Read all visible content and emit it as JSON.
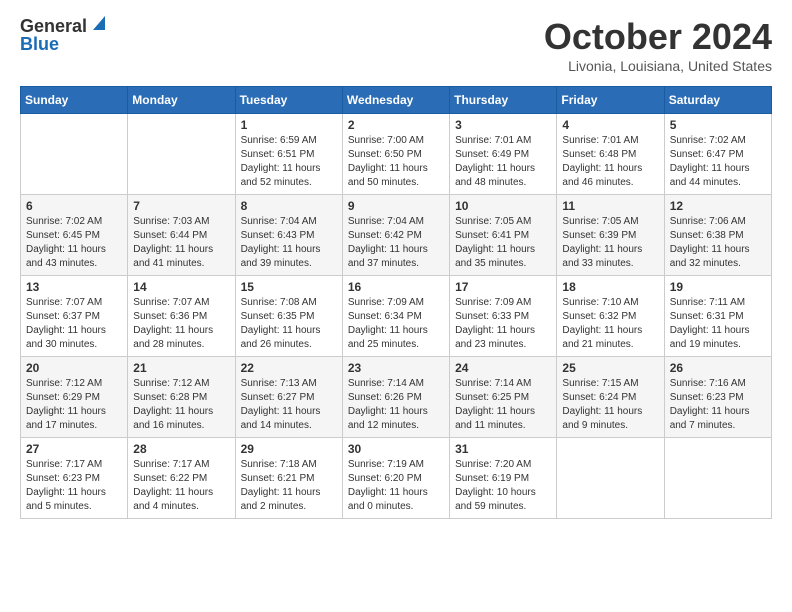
{
  "logo": {
    "general": "General",
    "blue": "Blue"
  },
  "header": {
    "month": "October 2024",
    "location": "Livonia, Louisiana, United States"
  },
  "weekdays": [
    "Sunday",
    "Monday",
    "Tuesday",
    "Wednesday",
    "Thursday",
    "Friday",
    "Saturday"
  ],
  "weeks": [
    [
      {
        "day": "",
        "info": ""
      },
      {
        "day": "",
        "info": ""
      },
      {
        "day": "1",
        "info": "Sunrise: 6:59 AM\nSunset: 6:51 PM\nDaylight: 11 hours\nand 52 minutes."
      },
      {
        "day": "2",
        "info": "Sunrise: 7:00 AM\nSunset: 6:50 PM\nDaylight: 11 hours\nand 50 minutes."
      },
      {
        "day": "3",
        "info": "Sunrise: 7:01 AM\nSunset: 6:49 PM\nDaylight: 11 hours\nand 48 minutes."
      },
      {
        "day": "4",
        "info": "Sunrise: 7:01 AM\nSunset: 6:48 PM\nDaylight: 11 hours\nand 46 minutes."
      },
      {
        "day": "5",
        "info": "Sunrise: 7:02 AM\nSunset: 6:47 PM\nDaylight: 11 hours\nand 44 minutes."
      }
    ],
    [
      {
        "day": "6",
        "info": "Sunrise: 7:02 AM\nSunset: 6:45 PM\nDaylight: 11 hours\nand 43 minutes."
      },
      {
        "day": "7",
        "info": "Sunrise: 7:03 AM\nSunset: 6:44 PM\nDaylight: 11 hours\nand 41 minutes."
      },
      {
        "day": "8",
        "info": "Sunrise: 7:04 AM\nSunset: 6:43 PM\nDaylight: 11 hours\nand 39 minutes."
      },
      {
        "day": "9",
        "info": "Sunrise: 7:04 AM\nSunset: 6:42 PM\nDaylight: 11 hours\nand 37 minutes."
      },
      {
        "day": "10",
        "info": "Sunrise: 7:05 AM\nSunset: 6:41 PM\nDaylight: 11 hours\nand 35 minutes."
      },
      {
        "day": "11",
        "info": "Sunrise: 7:05 AM\nSunset: 6:39 PM\nDaylight: 11 hours\nand 33 minutes."
      },
      {
        "day": "12",
        "info": "Sunrise: 7:06 AM\nSunset: 6:38 PM\nDaylight: 11 hours\nand 32 minutes."
      }
    ],
    [
      {
        "day": "13",
        "info": "Sunrise: 7:07 AM\nSunset: 6:37 PM\nDaylight: 11 hours\nand 30 minutes."
      },
      {
        "day": "14",
        "info": "Sunrise: 7:07 AM\nSunset: 6:36 PM\nDaylight: 11 hours\nand 28 minutes."
      },
      {
        "day": "15",
        "info": "Sunrise: 7:08 AM\nSunset: 6:35 PM\nDaylight: 11 hours\nand 26 minutes."
      },
      {
        "day": "16",
        "info": "Sunrise: 7:09 AM\nSunset: 6:34 PM\nDaylight: 11 hours\nand 25 minutes."
      },
      {
        "day": "17",
        "info": "Sunrise: 7:09 AM\nSunset: 6:33 PM\nDaylight: 11 hours\nand 23 minutes."
      },
      {
        "day": "18",
        "info": "Sunrise: 7:10 AM\nSunset: 6:32 PM\nDaylight: 11 hours\nand 21 minutes."
      },
      {
        "day": "19",
        "info": "Sunrise: 7:11 AM\nSunset: 6:31 PM\nDaylight: 11 hours\nand 19 minutes."
      }
    ],
    [
      {
        "day": "20",
        "info": "Sunrise: 7:12 AM\nSunset: 6:29 PM\nDaylight: 11 hours\nand 17 minutes."
      },
      {
        "day": "21",
        "info": "Sunrise: 7:12 AM\nSunset: 6:28 PM\nDaylight: 11 hours\nand 16 minutes."
      },
      {
        "day": "22",
        "info": "Sunrise: 7:13 AM\nSunset: 6:27 PM\nDaylight: 11 hours\nand 14 minutes."
      },
      {
        "day": "23",
        "info": "Sunrise: 7:14 AM\nSunset: 6:26 PM\nDaylight: 11 hours\nand 12 minutes."
      },
      {
        "day": "24",
        "info": "Sunrise: 7:14 AM\nSunset: 6:25 PM\nDaylight: 11 hours\nand 11 minutes."
      },
      {
        "day": "25",
        "info": "Sunrise: 7:15 AM\nSunset: 6:24 PM\nDaylight: 11 hours\nand 9 minutes."
      },
      {
        "day": "26",
        "info": "Sunrise: 7:16 AM\nSunset: 6:23 PM\nDaylight: 11 hours\nand 7 minutes."
      }
    ],
    [
      {
        "day": "27",
        "info": "Sunrise: 7:17 AM\nSunset: 6:23 PM\nDaylight: 11 hours\nand 5 minutes."
      },
      {
        "day": "28",
        "info": "Sunrise: 7:17 AM\nSunset: 6:22 PM\nDaylight: 11 hours\nand 4 minutes."
      },
      {
        "day": "29",
        "info": "Sunrise: 7:18 AM\nSunset: 6:21 PM\nDaylight: 11 hours\nand 2 minutes."
      },
      {
        "day": "30",
        "info": "Sunrise: 7:19 AM\nSunset: 6:20 PM\nDaylight: 11 hours\nand 0 minutes."
      },
      {
        "day": "31",
        "info": "Sunrise: 7:20 AM\nSunset: 6:19 PM\nDaylight: 10 hours\nand 59 minutes."
      },
      {
        "day": "",
        "info": ""
      },
      {
        "day": "",
        "info": ""
      }
    ]
  ]
}
